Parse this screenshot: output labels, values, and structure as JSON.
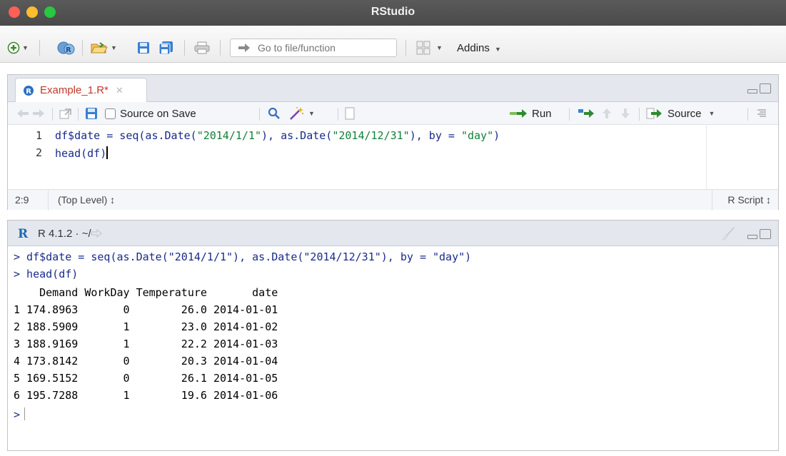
{
  "window": {
    "title": "RStudio"
  },
  "toolbar": {
    "goto_placeholder": "Go to file/function",
    "addins_label": "Addins"
  },
  "source": {
    "tab_label": "Example_1.R*",
    "source_on_save_label": "Source on Save",
    "run_label": "Run",
    "source_label": "Source",
    "code_lines": [
      {
        "num": "1",
        "prefix": "df$date = seq(as.Date(",
        "s1": "\"2014/1/1\"",
        "mid": "), as.Date(",
        "s2": "\"2014/12/31\"",
        "mid2": "), by = ",
        "s3": "\"day\"",
        "suffix": ")"
      },
      {
        "num": "2",
        "text": "head(df)"
      }
    ],
    "status": {
      "position": "2:9",
      "scope": "(Top Level) ↕",
      "file_type": "R Script ↕"
    }
  },
  "console": {
    "r_version": "R 4.1.2 · ~/",
    "commands": [
      "> df$date = seq(as.Date(\"2014/1/1\"), as.Date(\"2014/12/31\"), by = \"day\")",
      "> head(df)"
    ],
    "table_header": "    Demand WorkDay Temperature       date",
    "table_rows": [
      "1 174.8963       0        26.0 2014-01-01",
      "2 188.5909       1        23.0 2014-01-02",
      "3 188.9169       1        22.2 2014-01-03",
      "4 173.8142       0        20.3 2014-01-04",
      "5 169.5152       0        26.1 2014-01-05",
      "6 195.7288       1        19.6 2014-01-06"
    ],
    "prompt": ">"
  },
  "colors": {
    "string": "#13803a",
    "code": "#1a2a8a",
    "tab_modified": "#c0392b"
  }
}
